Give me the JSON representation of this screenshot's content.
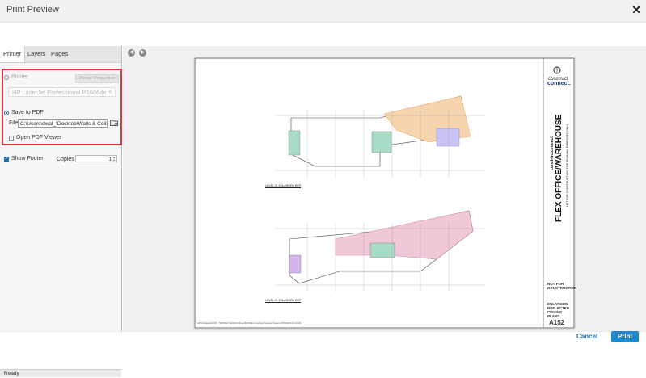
{
  "window": {
    "title": "Print Preview",
    "close_label": "✕"
  },
  "tabs": [
    "Printer",
    "Layers",
    "Pages"
  ],
  "printer": {
    "radio_label": "Printer",
    "properties_button": "Printer Properties",
    "selected_printer": "HP LaserJet Professional P1606dn"
  },
  "pdf": {
    "radio_label": "Save to PDF",
    "file_label": "File :",
    "file_path": "C:\\Users\\dwal_\\Desktop\\Walls & Ceilings",
    "open_viewer_label": "Open PDF Viewer",
    "open_viewer_checked": true
  },
  "options": {
    "show_footer_label": "Show Footer",
    "show_footer_checked": true,
    "copies_label": "Copies :",
    "copies_value": "1"
  },
  "status": "Ready",
  "sheet": {
    "logo_top": "construct",
    "logo_bottom": "connect.",
    "brand_small": "constructconnect",
    "project_title": "FLEX OFFICE/WAREHOUSE",
    "not_for_construction_vertical": "NOT FOR CONSTRUCTION. FOR TRAINING PURPOSES ONLY",
    "stamp": "NOT FOR CONSTRUCTION",
    "sheet_title": "ENLARGED REFLECTED CEILING PLANS",
    "sheet_number": "A152",
    "plan_label_top": "LEVEL 01 ENLARGED RCP",
    "plan_label_bottom": "LEVEL 01 ENLARGED RCP",
    "footer_text": "A152 Enlarged RCP - 7665 REV 32MHCC Rose Bld Walls & Ceilings Sample Project 1/25/2023 9:30:44 AM"
  },
  "actions": {
    "cancel": "Cancel",
    "print": "Print"
  }
}
